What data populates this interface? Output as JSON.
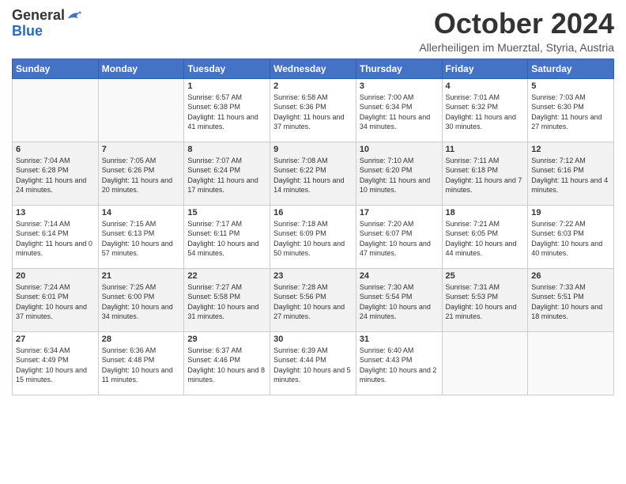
{
  "logo": {
    "general": "General",
    "blue": "Blue"
  },
  "title": "October 2024",
  "subtitle": "Allerheiligen im Muerztal, Styria, Austria",
  "weekdays": [
    "Sunday",
    "Monday",
    "Tuesday",
    "Wednesday",
    "Thursday",
    "Friday",
    "Saturday"
  ],
  "weeks": [
    [
      {
        "day": "",
        "info": ""
      },
      {
        "day": "",
        "info": ""
      },
      {
        "day": "1",
        "info": "Sunrise: 6:57 AM\nSunset: 6:38 PM\nDaylight: 11 hours and 41 minutes."
      },
      {
        "day": "2",
        "info": "Sunrise: 6:58 AM\nSunset: 6:36 PM\nDaylight: 11 hours and 37 minutes."
      },
      {
        "day": "3",
        "info": "Sunrise: 7:00 AM\nSunset: 6:34 PM\nDaylight: 11 hours and 34 minutes."
      },
      {
        "day": "4",
        "info": "Sunrise: 7:01 AM\nSunset: 6:32 PM\nDaylight: 11 hours and 30 minutes."
      },
      {
        "day": "5",
        "info": "Sunrise: 7:03 AM\nSunset: 6:30 PM\nDaylight: 11 hours and 27 minutes."
      }
    ],
    [
      {
        "day": "6",
        "info": "Sunrise: 7:04 AM\nSunset: 6:28 PM\nDaylight: 11 hours and 24 minutes."
      },
      {
        "day": "7",
        "info": "Sunrise: 7:05 AM\nSunset: 6:26 PM\nDaylight: 11 hours and 20 minutes."
      },
      {
        "day": "8",
        "info": "Sunrise: 7:07 AM\nSunset: 6:24 PM\nDaylight: 11 hours and 17 minutes."
      },
      {
        "day": "9",
        "info": "Sunrise: 7:08 AM\nSunset: 6:22 PM\nDaylight: 11 hours and 14 minutes."
      },
      {
        "day": "10",
        "info": "Sunrise: 7:10 AM\nSunset: 6:20 PM\nDaylight: 11 hours and 10 minutes."
      },
      {
        "day": "11",
        "info": "Sunrise: 7:11 AM\nSunset: 6:18 PM\nDaylight: 11 hours and 7 minutes."
      },
      {
        "day": "12",
        "info": "Sunrise: 7:12 AM\nSunset: 6:16 PM\nDaylight: 11 hours and 4 minutes."
      }
    ],
    [
      {
        "day": "13",
        "info": "Sunrise: 7:14 AM\nSunset: 6:14 PM\nDaylight: 11 hours and 0 minutes."
      },
      {
        "day": "14",
        "info": "Sunrise: 7:15 AM\nSunset: 6:13 PM\nDaylight: 10 hours and 57 minutes."
      },
      {
        "day": "15",
        "info": "Sunrise: 7:17 AM\nSunset: 6:11 PM\nDaylight: 10 hours and 54 minutes."
      },
      {
        "day": "16",
        "info": "Sunrise: 7:18 AM\nSunset: 6:09 PM\nDaylight: 10 hours and 50 minutes."
      },
      {
        "day": "17",
        "info": "Sunrise: 7:20 AM\nSunset: 6:07 PM\nDaylight: 10 hours and 47 minutes."
      },
      {
        "day": "18",
        "info": "Sunrise: 7:21 AM\nSunset: 6:05 PM\nDaylight: 10 hours and 44 minutes."
      },
      {
        "day": "19",
        "info": "Sunrise: 7:22 AM\nSunset: 6:03 PM\nDaylight: 10 hours and 40 minutes."
      }
    ],
    [
      {
        "day": "20",
        "info": "Sunrise: 7:24 AM\nSunset: 6:01 PM\nDaylight: 10 hours and 37 minutes."
      },
      {
        "day": "21",
        "info": "Sunrise: 7:25 AM\nSunset: 6:00 PM\nDaylight: 10 hours and 34 minutes."
      },
      {
        "day": "22",
        "info": "Sunrise: 7:27 AM\nSunset: 5:58 PM\nDaylight: 10 hours and 31 minutes."
      },
      {
        "day": "23",
        "info": "Sunrise: 7:28 AM\nSunset: 5:56 PM\nDaylight: 10 hours and 27 minutes."
      },
      {
        "day": "24",
        "info": "Sunrise: 7:30 AM\nSunset: 5:54 PM\nDaylight: 10 hours and 24 minutes."
      },
      {
        "day": "25",
        "info": "Sunrise: 7:31 AM\nSunset: 5:53 PM\nDaylight: 10 hours and 21 minutes."
      },
      {
        "day": "26",
        "info": "Sunrise: 7:33 AM\nSunset: 5:51 PM\nDaylight: 10 hours and 18 minutes."
      }
    ],
    [
      {
        "day": "27",
        "info": "Sunrise: 6:34 AM\nSunset: 4:49 PM\nDaylight: 10 hours and 15 minutes."
      },
      {
        "day": "28",
        "info": "Sunrise: 6:36 AM\nSunset: 4:48 PM\nDaylight: 10 hours and 11 minutes."
      },
      {
        "day": "29",
        "info": "Sunrise: 6:37 AM\nSunset: 4:46 PM\nDaylight: 10 hours and 8 minutes."
      },
      {
        "day": "30",
        "info": "Sunrise: 6:39 AM\nSunset: 4:44 PM\nDaylight: 10 hours and 5 minutes."
      },
      {
        "day": "31",
        "info": "Sunrise: 6:40 AM\nSunset: 4:43 PM\nDaylight: 10 hours and 2 minutes."
      },
      {
        "day": "",
        "info": ""
      },
      {
        "day": "",
        "info": ""
      }
    ]
  ]
}
